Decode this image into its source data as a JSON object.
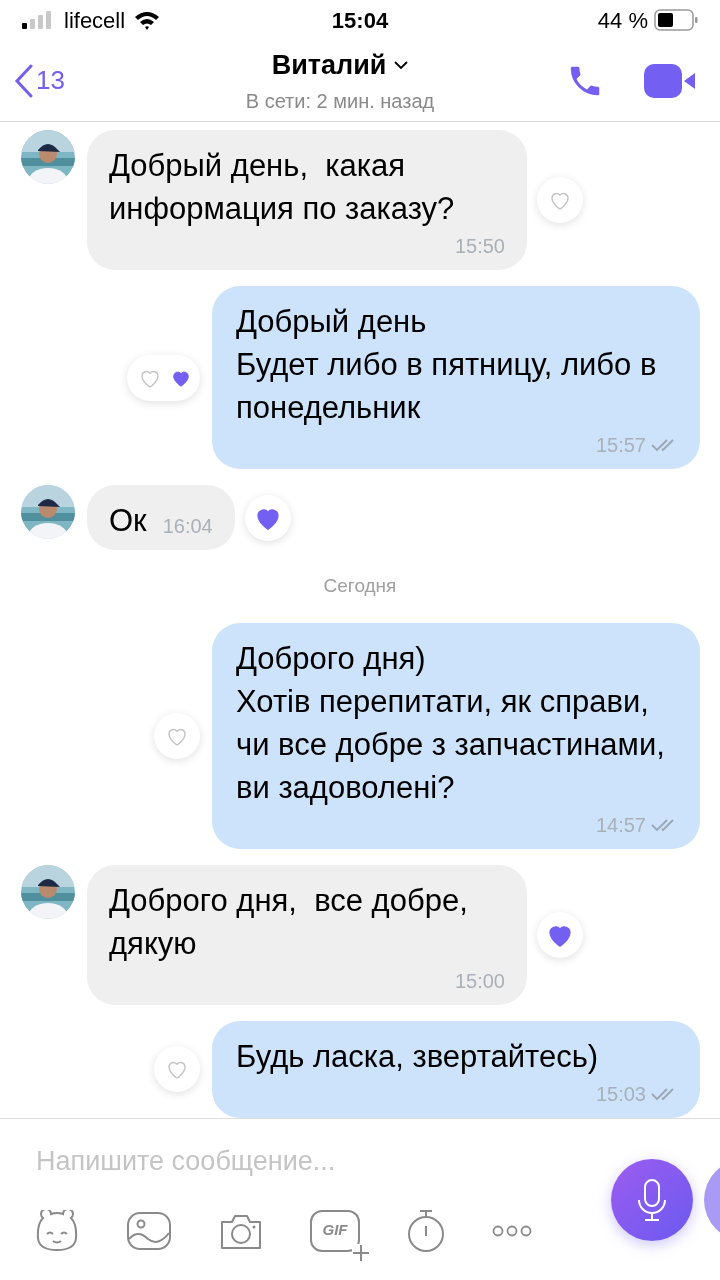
{
  "status_bar": {
    "carrier": "lifecell",
    "time": "15:04",
    "battery": "44 %"
  },
  "header": {
    "back_count": "13",
    "name": "Виталий",
    "status": "В сети: 2 мин. назад"
  },
  "messages": [
    {
      "kind": "incoming",
      "text": "Добрый день,  какая информация по заказу?",
      "time": "15:50",
      "liked": false,
      "reacted": false
    },
    {
      "kind": "outgoing",
      "text": "Добрый день\nБудет либо в пятницу, либо в понедельник",
      "time": "15:57",
      "liked": false,
      "reacted": true
    },
    {
      "kind": "incoming",
      "text": "Ок",
      "time": "16:04",
      "liked": true,
      "reacted": false
    },
    {
      "kind": "separator",
      "text": "Сегодня"
    },
    {
      "kind": "outgoing",
      "text": "Доброго дня)\nХотів перепитати, як справи, чи все добре з запчастинами, ви задоволені?",
      "time": "14:57",
      "liked": false,
      "reacted": false
    },
    {
      "kind": "incoming",
      "text": "Доброго дня,  все добре, дякую",
      "time": "15:00",
      "liked": true,
      "reacted": false
    },
    {
      "kind": "outgoing",
      "text": "Будь ласка, звертайтесь)",
      "time": "15:03",
      "liked": false,
      "reacted": false
    }
  ],
  "composer": {
    "placeholder": "Напишите сообщение...",
    "gif_label": "GIF"
  }
}
